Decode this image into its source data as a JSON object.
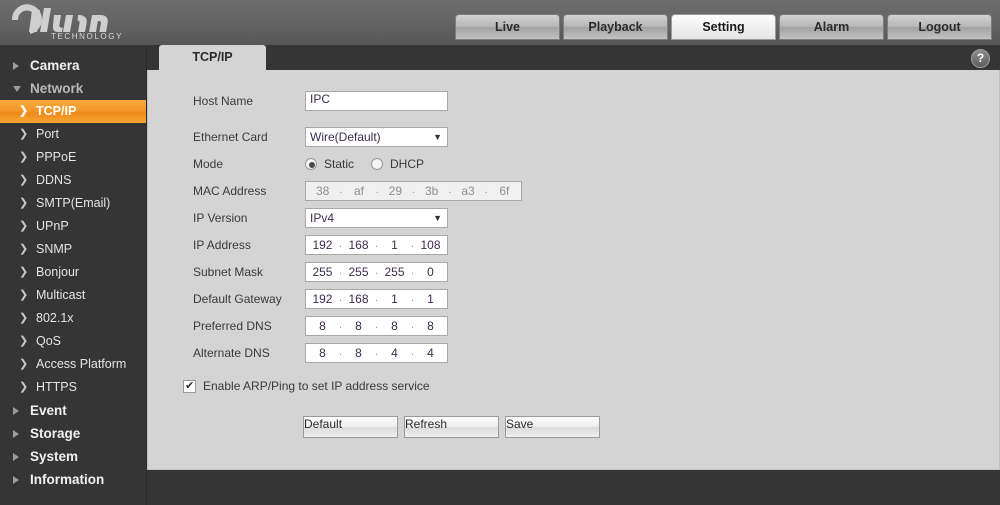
{
  "header": {
    "brand": "alhua",
    "brand_sub": "TECHNOLOGY",
    "nav": [
      {
        "label": "Live",
        "active": false
      },
      {
        "label": "Playback",
        "active": false
      },
      {
        "label": "Setting",
        "active": true
      },
      {
        "label": "Alarm",
        "active": false
      },
      {
        "label": "Logout",
        "active": false
      }
    ]
  },
  "sidebar": {
    "groups": [
      {
        "label": "Camera",
        "open": false,
        "items": []
      },
      {
        "label": "Network",
        "open": true,
        "items": [
          {
            "label": "TCP/IP",
            "active": true
          },
          {
            "label": "Port",
            "active": false
          },
          {
            "label": "PPPoE",
            "active": false
          },
          {
            "label": "DDNS",
            "active": false
          },
          {
            "label": "SMTP(Email)",
            "active": false
          },
          {
            "label": "UPnP",
            "active": false
          },
          {
            "label": "SNMP",
            "active": false
          },
          {
            "label": "Bonjour",
            "active": false
          },
          {
            "label": "Multicast",
            "active": false
          },
          {
            "label": "802.1x",
            "active": false
          },
          {
            "label": "QoS",
            "active": false
          },
          {
            "label": "Access Platform",
            "active": false
          },
          {
            "label": "HTTPS",
            "active": false
          }
        ]
      },
      {
        "label": "Event",
        "open": false,
        "items": []
      },
      {
        "label": "Storage",
        "open": false,
        "items": []
      },
      {
        "label": "System",
        "open": false,
        "items": []
      },
      {
        "label": "Information",
        "open": false,
        "items": []
      }
    ]
  },
  "content": {
    "tab_label": "TCP/IP",
    "help_glyph": "?",
    "dropdown_arrow": "▼",
    "form": {
      "host_name": {
        "label": "Host Name",
        "value": "IPC"
      },
      "ethernet_card": {
        "label": "Ethernet Card",
        "value": "Wire(Default)"
      },
      "mode": {
        "label": "Mode",
        "options": [
          {
            "label": "Static",
            "selected": true
          },
          {
            "label": "DHCP",
            "selected": false
          }
        ]
      },
      "mac_address": {
        "label": "MAC Address",
        "octets": [
          "38",
          "af",
          "29",
          "3b",
          "a3",
          "6f"
        ],
        "readonly": true
      },
      "ip_version": {
        "label": "IP Version",
        "value": "IPv4"
      },
      "ip_address": {
        "label": "IP Address",
        "octets": [
          "192",
          "168",
          "1",
          "108"
        ]
      },
      "subnet_mask": {
        "label": "Subnet Mask",
        "octets": [
          "255",
          "255",
          "255",
          "0"
        ]
      },
      "default_gateway": {
        "label": "Default Gateway",
        "octets": [
          "192",
          "168",
          "1",
          "1"
        ]
      },
      "preferred_dns": {
        "label": "Preferred DNS",
        "octets": [
          "8",
          "8",
          "8",
          "8"
        ]
      },
      "alternate_dns": {
        "label": "Alternate DNS",
        "octets": [
          "8",
          "8",
          "4",
          "4"
        ]
      },
      "arp_ping": {
        "label": "Enable ARP/Ping to set IP address service",
        "checked": true
      },
      "separator": "."
    },
    "buttons": [
      {
        "label": "Default"
      },
      {
        "label": "Refresh"
      },
      {
        "label": "Save"
      }
    ]
  },
  "colors": {
    "accent_orange": "#ef8a18",
    "header_gray": "#636363",
    "sidebar_dark": "#353535",
    "panel_gray": "#d4d4d4"
  }
}
